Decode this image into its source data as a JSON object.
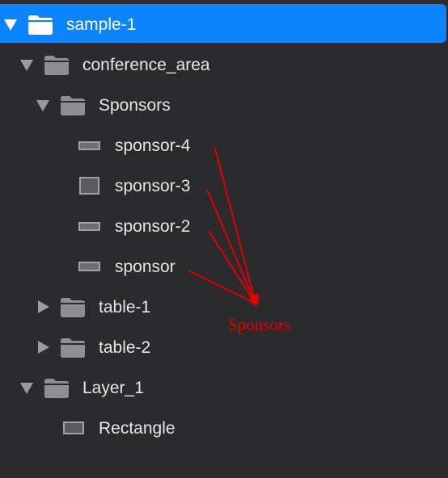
{
  "layers_panel": {
    "items": [
      {
        "label": "sample-1",
        "type": "folder",
        "state": "expanded",
        "selected": true
      },
      {
        "label": "conference_area",
        "type": "folder",
        "state": "expanded"
      },
      {
        "label": "Sponsors",
        "type": "folder",
        "state": "expanded"
      },
      {
        "label": "sponsor-4",
        "type": "layer"
      },
      {
        "label": "sponsor-3",
        "type": "layer"
      },
      {
        "label": "sponsor-2",
        "type": "layer"
      },
      {
        "label": "sponsor",
        "type": "layer"
      },
      {
        "label": "table-1",
        "type": "folder",
        "state": "collapsed"
      },
      {
        "label": "table-2",
        "type": "folder",
        "state": "collapsed"
      },
      {
        "label": "Layer_1",
        "type": "folder",
        "state": "expanded"
      },
      {
        "label": "Rectangle",
        "type": "layer"
      }
    ]
  },
  "annotation": {
    "text": "Sponsors",
    "color": "#e20000"
  },
  "colors": {
    "selection": "#0a84ff",
    "background": "#2b2b2d",
    "text": "#e6e6e6",
    "icon": "#8e8e93"
  },
  "icons": {
    "folder": "folder-icon",
    "layer": "rectangle-layer-icon",
    "expand": "triangle-down-icon",
    "collapse": "triangle-right-icon"
  }
}
